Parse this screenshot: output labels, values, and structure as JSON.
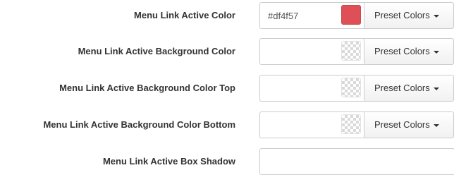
{
  "rows": [
    {
      "label": "Menu Link Active Color",
      "value": "#df4f57",
      "swatch_color": "#df4f57",
      "button_label": "Preset Colors",
      "button_icon": "caret-down-icon"
    },
    {
      "label": "Menu Link Active Background Color",
      "value": "",
      "swatch_color": "transparent",
      "button_label": "Preset Colors",
      "button_icon": "caret-down-icon"
    },
    {
      "label": "Menu Link Active Background Color Top",
      "value": "",
      "swatch_color": "transparent",
      "button_label": "Preset Colors",
      "button_icon": "caret-down-icon"
    },
    {
      "label": "Menu Link Active Background Color Bottom",
      "value": "",
      "swatch_color": "transparent",
      "button_label": "Preset Colors",
      "button_icon": "caret-down-icon"
    },
    {
      "label": "Menu Link Active Box Shadow",
      "value": ""
    }
  ],
  "colors": {
    "label_text": "#333333",
    "input_border": "#cccccc",
    "active_swatch": "#df4f57"
  }
}
